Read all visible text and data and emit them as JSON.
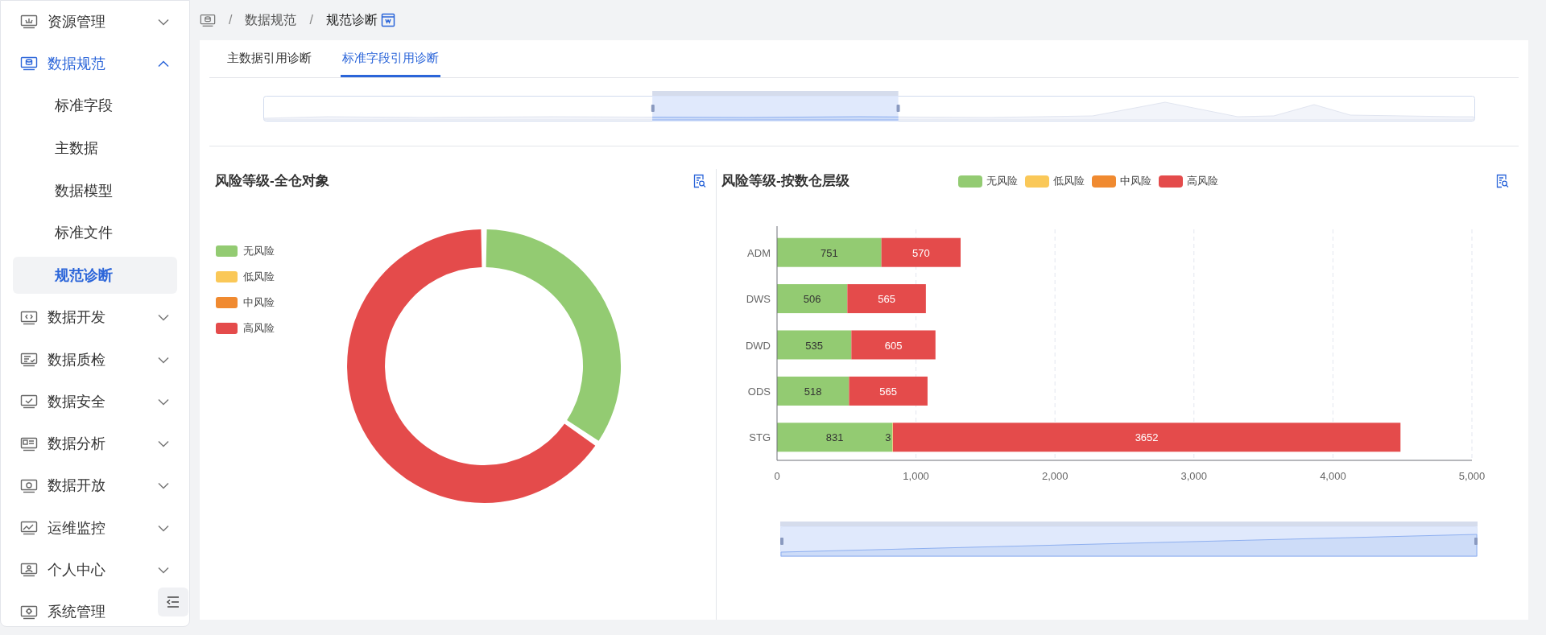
{
  "sidebar": {
    "items": [
      {
        "label": "资源管理",
        "selected": false,
        "expanded": false
      },
      {
        "label": "数据规范",
        "selected": true,
        "expanded": true,
        "children": [
          {
            "label": "标准字段",
            "selected": false
          },
          {
            "label": "主数据",
            "selected": false
          },
          {
            "label": "数据模型",
            "selected": false
          },
          {
            "label": "标准文件",
            "selected": false
          },
          {
            "label": "规范诊断",
            "selected": true
          }
        ]
      },
      {
        "label": "数据开发",
        "selected": false,
        "expanded": false
      },
      {
        "label": "数据质检",
        "selected": false,
        "expanded": false
      },
      {
        "label": "数据安全",
        "selected": false,
        "expanded": false
      },
      {
        "label": "数据分析",
        "selected": false,
        "expanded": false
      },
      {
        "label": "数据开放",
        "selected": false,
        "expanded": false
      },
      {
        "label": "运维监控",
        "selected": false,
        "expanded": false
      },
      {
        "label": "个人中心",
        "selected": false,
        "expanded": false
      },
      {
        "label": "系统管理",
        "selected": false
      }
    ]
  },
  "breadcrumb": [
    {
      "kind": "separator",
      "text": "/"
    },
    {
      "kind": "link",
      "text": "数据规范"
    },
    {
      "kind": "separator",
      "text": "/"
    },
    {
      "kind": "current",
      "text": "规范诊断"
    }
  ],
  "tabs": [
    {
      "label": "主数据引用诊断",
      "selected": false
    },
    {
      "label": "标准字段引用诊断",
      "selected": true
    }
  ],
  "overview_slider": {
    "handles": [
      {
        "level": 0.321
      },
      {
        "level": 0.524
      }
    ]
  },
  "overall_panel": {
    "title": "风险等级-全仓对象",
    "legend": [
      {
        "label": "无风险",
        "color": "#93cb72"
      },
      {
        "label": "低风险",
        "color": "#fac858"
      },
      {
        "label": "中风险",
        "color": "#f08a30"
      },
      {
        "label": "高风险",
        "color": "#e44b4b"
      }
    ]
  },
  "layer_panel": {
    "title": "风险等级-按数仓层级",
    "chart_data": {
      "type": "bar",
      "orientation": "horizontal",
      "stacked": true,
      "data_labels": true,
      "grid": true,
      "categories": [
        "ADM",
        "DWS",
        "DWD",
        "ODS",
        "STG"
      ],
      "series": [
        {
          "name": "无风险",
          "color": "#93cb72",
          "values": [
            751,
            506,
            535,
            518,
            831
          ]
        },
        {
          "name": "低风险",
          "color": "#fac858",
          "values": [
            null,
            null,
            null,
            null,
            3
          ]
        },
        {
          "name": "中风险",
          "color": "#f08a30",
          "values": [
            null,
            null,
            null,
            null,
            null
          ]
        },
        {
          "name": "高风险",
          "color": "#e44b4b",
          "values": [
            570,
            565,
            605,
            565,
            3652
          ]
        }
      ],
      "xlim": [
        0,
        5000
      ],
      "xticks": [
        0,
        {
          "value": 1000,
          "label": "1,000"
        },
        {
          "value": 2000,
          "label": "2,000"
        },
        {
          "value": 3000,
          "label": "3,000"
        },
        {
          "value": 4000,
          "label": "4,000"
        },
        {
          "value": 5000,
          "label": "5,000"
        }
      ]
    },
    "zoom_slider": {
      "handles": [
        {
          "level": 0
        },
        {
          "level": 1
        }
      ]
    }
  }
}
